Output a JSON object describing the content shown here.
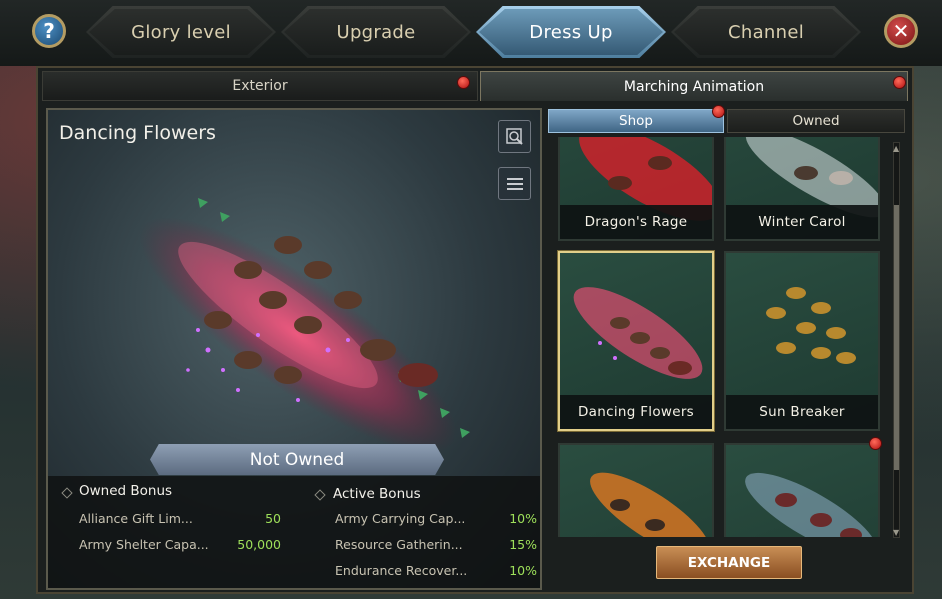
{
  "nav": {
    "tabs": [
      {
        "label": "Glory level"
      },
      {
        "label": "Upgrade"
      },
      {
        "label": "Dress Up",
        "active": true
      },
      {
        "label": "Channel"
      }
    ],
    "help_glyph": "?",
    "close_glyph": "✕"
  },
  "subtabs": {
    "exterior": "Exterior",
    "marching": "Marching Animation"
  },
  "preview": {
    "title": "Dancing Flowers",
    "status": "Not Owned",
    "icons": [
      "zoom-preview-icon",
      "list-icon"
    ]
  },
  "owned_bonus": {
    "heading": "Owned Bonus",
    "items": [
      {
        "name": "Alliance Gift Lim...",
        "value": "50"
      },
      {
        "name": "Army Shelter Capa...",
        "value": "50,000"
      }
    ]
  },
  "active_bonus": {
    "heading": "Active Bonus",
    "items": [
      {
        "name": "Army Carrying Cap...",
        "value": "10%"
      },
      {
        "name": "Resource Gatherin...",
        "value": "15%"
      },
      {
        "name": "Endurance Recover...",
        "value": "10%"
      }
    ]
  },
  "shop": {
    "tabs": {
      "shop": "Shop",
      "owned": "Owned"
    },
    "cards": [
      {
        "label": "Dragon's Rage",
        "theme": "red"
      },
      {
        "label": "Winter Carol",
        "theme": "white"
      },
      {
        "label": "Dancing Flowers",
        "theme": "pink",
        "selected": true
      },
      {
        "label": "Sun Breaker",
        "theme": "gold"
      },
      {
        "label": "",
        "theme": "fire"
      },
      {
        "label": "",
        "theme": "ice",
        "badge": true
      }
    ],
    "exchange_label": "EXCHANGE"
  },
  "colors": {
    "accent_blue": "#6c9ab8",
    "bonus_green": "#9ee05a",
    "badge_red": "#d81e1e",
    "exchange_orange": "#b07040",
    "selected_gold": "#e2cf8a"
  }
}
